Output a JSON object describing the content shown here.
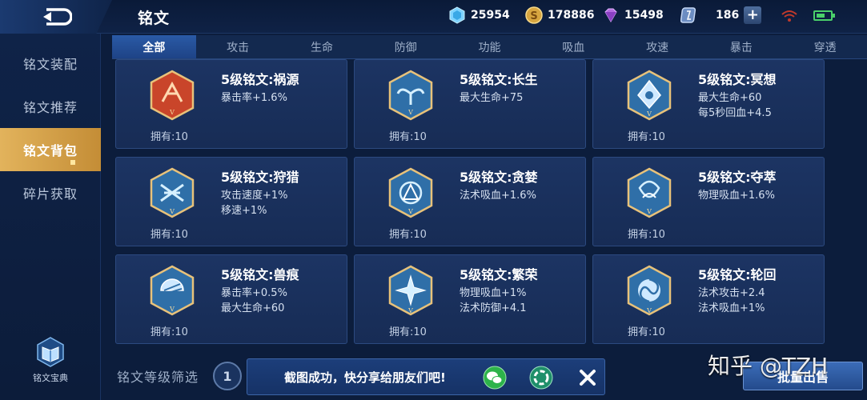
{
  "header": {
    "title": "铭文",
    "currencies": [
      {
        "icon": "crystal-icon",
        "value": "25954"
      },
      {
        "icon": "gold-coin-icon",
        "value": "178886"
      },
      {
        "icon": "diamond-icon",
        "value": "15498"
      },
      {
        "icon": "voucher-icon",
        "value": "186"
      }
    ],
    "add_label": "+"
  },
  "sidebar": {
    "items": [
      {
        "label": "铭文装配"
      },
      {
        "label": "铭文推荐"
      },
      {
        "label": "铭文背包"
      },
      {
        "label": "碎片获取"
      }
    ],
    "codex_label": "铭文宝典"
  },
  "tabs": [
    "全部",
    "攻击",
    "生命",
    "防御",
    "功能",
    "吸血",
    "攻速",
    "暴击",
    "穿透"
  ],
  "inscriptions": [
    {
      "name": "5级铭文:祸源",
      "attrs": [
        "暴击率+1.6%",
        ""
      ],
      "owned": "拥有:10",
      "color": "#c9452a"
    },
    {
      "name": "5级铭文:长生",
      "attrs": [
        "最大生命+75",
        ""
      ],
      "owned": "拥有:10",
      "color": "#2f6fa8"
    },
    {
      "name": "5级铭文:冥想",
      "attrs": [
        "最大生命+60",
        "每5秒回血+4.5"
      ],
      "owned": "拥有:10",
      "color": "#2f6fa8"
    },
    {
      "name": "5级铭文:狩猎",
      "attrs": [
        "攻击速度+1%",
        "移速+1%"
      ],
      "owned": "拥有:10",
      "color": "#2f6fa8"
    },
    {
      "name": "5级铭文:贪婪",
      "attrs": [
        "法术吸血+1.6%",
        ""
      ],
      "owned": "拥有:10",
      "color": "#2f6fa8"
    },
    {
      "name": "5级铭文:夺萃",
      "attrs": [
        "物理吸血+1.6%",
        ""
      ],
      "owned": "拥有:10",
      "color": "#2f6fa8"
    },
    {
      "name": "5级铭文:兽痕",
      "attrs": [
        "暴击率+0.5%",
        "最大生命+60"
      ],
      "owned": "拥有:10",
      "color": "#2f6fa8"
    },
    {
      "name": "5级铭文:繁荣",
      "attrs": [
        "物理吸血+1%",
        "法术防御+4.1"
      ],
      "owned": "拥有:10",
      "color": "#2f6fa8"
    },
    {
      "name": "5级铭文:轮回",
      "attrs": [
        "法术攻击+2.4",
        "法术吸血+1%"
      ],
      "owned": "拥有:10",
      "color": "#2f6fa8"
    }
  ],
  "footer": {
    "filter_label": "铭文等级筛选",
    "level": "1",
    "bulk_sell": "批量出售",
    "toast_text": "截图成功，快分享给朋友们吧!",
    "watermark": "知乎 @TZH"
  }
}
